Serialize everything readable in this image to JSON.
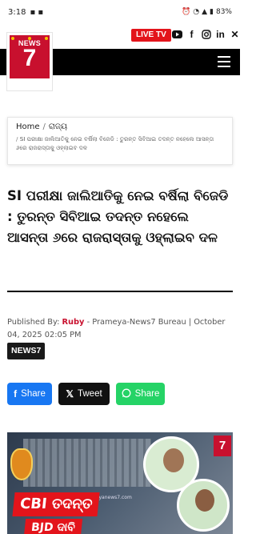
{
  "status_bar": {
    "time": "3:18",
    "battery": "83%"
  },
  "header": {
    "live_tv_label": "LIVE TV",
    "social_icons": [
      "youtube-icon",
      "facebook-icon",
      "instagram-icon",
      "linkedin-icon",
      "x-icon"
    ],
    "logo_text": "NEWS",
    "logo_number": "7"
  },
  "breadcrumb": {
    "home": "Home",
    "separator": "/",
    "category": "ରାଜ୍ୟ",
    "current": "SI ପରୀକ୍ଷା ଜାଲିଆତିକୁ ନେଇ ବର୍ଷିଲା ବିଜେଡି : ତୁରନ୍ତ ସିବିଆଇ ତଦନ୍ତ ନହେଲେ ଆସନ୍ତା ୬ରେ ରାଜରାସ୍ତାକୁ ଓହ୍ଲାଇବ ଦଳ"
  },
  "article": {
    "headline": "SI ପରୀକ୍ଷା ଜାଲିଆତିକୁ ନେଇ ବର୍ଷିଲା ବିଜେଡି : ତୁରନ୍ତ ସିବିଆଇ ତଦନ୍ତ ନହେଲେ ଆସନ୍ତା ୬ରେ ରାଜରାସ୍ତାକୁ ଓହ୍ଲାଇବ ଦଳ",
    "published_by_label": "Published By:",
    "author": "Ruby",
    "source": "- Prameya-News7 Bureau | October 04, 2025 02:05 PM",
    "tag": "NEWS7"
  },
  "share": {
    "facebook_label": "Share",
    "twitter_label": "Tweet",
    "whatsapp_label": "Share"
  },
  "hero": {
    "banner_line1": "CBI ତଦନ୍ତ",
    "banner_line2": "BJD ଦାବି",
    "watermark": "prameyanews7.com",
    "channel_logo": "7"
  },
  "colors": {
    "brand_red": "#c8102e",
    "live_red": "#e3141b",
    "facebook": "#1877f2",
    "twitter": "#111111",
    "whatsapp": "#25d366"
  }
}
